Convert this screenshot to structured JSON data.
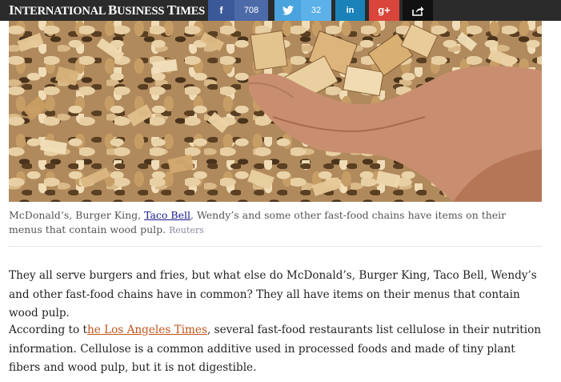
{
  "header": {
    "logo": {
      "initial1": "I",
      "part1": "NTERNATIONAL ",
      "initial2": "B",
      "part2": "USINESS ",
      "initial3": "T",
      "part3": "IMES"
    },
    "share": {
      "facebook": {
        "icon": "f",
        "count": "708"
      },
      "twitter": {
        "icon": "twitter-bird",
        "count": "32"
      },
      "linkedin": {
        "icon": "in"
      },
      "googleplus": {
        "icon": "g+"
      },
      "share": {
        "icon": "share-arrow"
      }
    }
  },
  "photo": {
    "subject": "hand holding wood chips over a pile of wood chips"
  },
  "caption": {
    "before_link": "McDonald’s, Burger King, ",
    "link": "Taco Bell",
    "after_link": ", Wendy’s and some other fast-food chains have items on their menus that contain wood pulp.",
    "credit": "Reuters"
  },
  "article": {
    "p1": "They all serve burgers and fries, but what else do McDonald’s, Burger King, Taco Bell, Wendy’s and other fast-food chains have in common? They all have items on their menus that contain wood pulp.",
    "p2_before": "According to t",
    "p2_link": "he Los Angeles Times",
    "p2_after": ", several fast-food restaurants list cellulose in their nutrition information. Cellulose is a common additive used in processed foods and made of tiny plant fibers and wood pulp, but it is not digestible."
  },
  "colors": {
    "facebook": "#3b5998",
    "twitter": "#4ba3de",
    "linkedin": "#1a82b8",
    "googleplus": "#d9453a",
    "link": "#c0541b"
  }
}
